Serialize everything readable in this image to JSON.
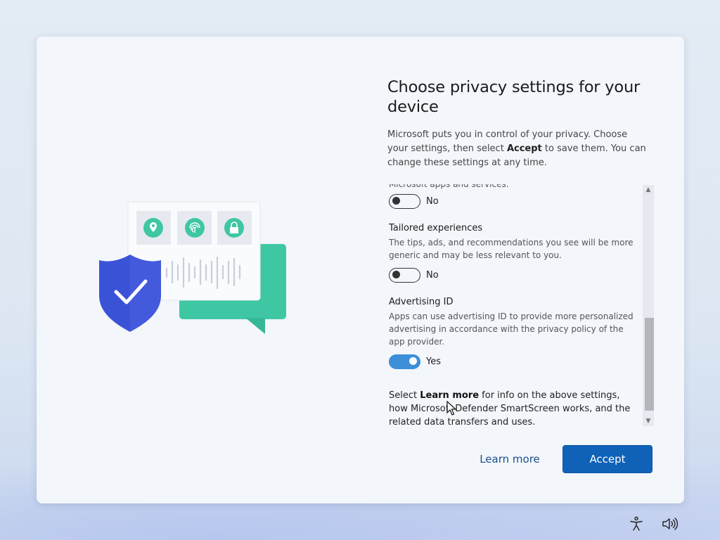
{
  "dialog": {
    "title": "Choose privacy settings for your device",
    "intro_part1": "Microsoft puts you in control of your privacy. Choose your settings, then select ",
    "intro_bold": "Accept",
    "intro_part2": " to save them. You can change these settings at any time."
  },
  "settings": {
    "clipped_text": "Microsoft apps and services.",
    "first_toggle": {
      "state": "No",
      "on": false
    },
    "tailored": {
      "title": "Tailored experiences",
      "description": "The tips, ads, and recommendations you see will be more generic and may be less relevant to you.",
      "state": "No",
      "on": false
    },
    "advertising": {
      "title": "Advertising ID",
      "description": "Apps can use advertising ID to provide more personalized advertising in accordance with the privacy policy of the app provider.",
      "state": "Yes",
      "on": true
    },
    "footer_part1": "Select ",
    "footer_bold": "Learn more",
    "footer_part2": " for info on the above settings, how Microsoft Defender SmartScreen works, and the related data transfers and uses."
  },
  "buttons": {
    "learn_more": "Learn more",
    "accept": "Accept"
  },
  "scrollbar": {
    "up_arrow": "▲",
    "down_arrow": "▼"
  },
  "taskbar": {
    "icons": [
      "accessibility-icon",
      "volume-icon"
    ]
  },
  "colors": {
    "accent": "#0f62b8",
    "toggle_on": "#3d8fd9",
    "shield": "#3a53d6",
    "chat": "#3fc7a4"
  }
}
